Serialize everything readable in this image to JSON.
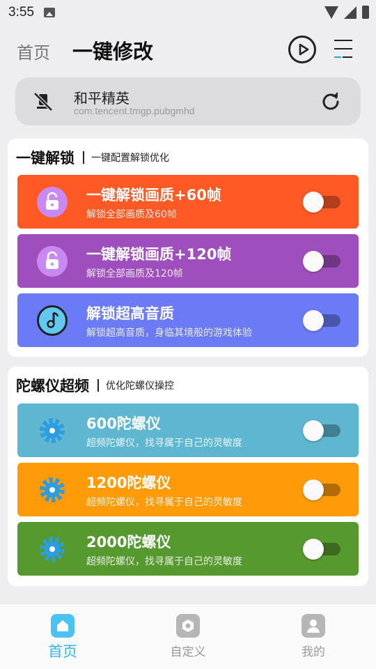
{
  "status": {
    "time": "3:55"
  },
  "header": {
    "tab_home": "首页",
    "title": "一键修改"
  },
  "game": {
    "name": "和平精英",
    "package": "com.tencent.tmgp.pubgmhd"
  },
  "sections": [
    {
      "title": "一键解锁",
      "subtitle": "一键配置解锁优化",
      "items": [
        {
          "title": "一键解锁画质+60帧",
          "desc": "解锁全部画质及60帧",
          "color": "#ff5a26",
          "icon": "lock-icon",
          "enabled": false
        },
        {
          "title": "一键解锁画质+120帧",
          "desc": "解锁全部画质及120帧",
          "color": "#9e4fbd",
          "icon": "lock-icon",
          "enabled": false
        },
        {
          "title": "解锁超高音质",
          "desc": "解锁超高音质，身临其境般的游戏体验",
          "color": "#6b7bf6",
          "icon": "music-icon",
          "enabled": false
        }
      ]
    },
    {
      "title": "陀螺仪超频",
      "subtitle": "优化陀螺仪操控",
      "items": [
        {
          "title": "600陀螺仪",
          "desc": "超频陀螺仪，找寻属于自己的灵敏度",
          "color": "#5eb6d1",
          "icon": "gear-icon",
          "enabled": false
        },
        {
          "title": "1200陀螺仪",
          "desc": "超频陀螺仪，找寻属于自己的灵敏度",
          "color": "#ff9a08",
          "icon": "gear-icon",
          "enabled": false
        },
        {
          "title": "2000陀螺仪",
          "desc": "超频陀螺仪，找寻属于自己的灵敏度",
          "color": "#56992f",
          "icon": "gear-icon",
          "enabled": false
        }
      ]
    }
  ],
  "nav": [
    {
      "label": "首页",
      "active": true
    },
    {
      "label": "自定义",
      "active": false
    },
    {
      "label": "我的",
      "active": false
    }
  ]
}
